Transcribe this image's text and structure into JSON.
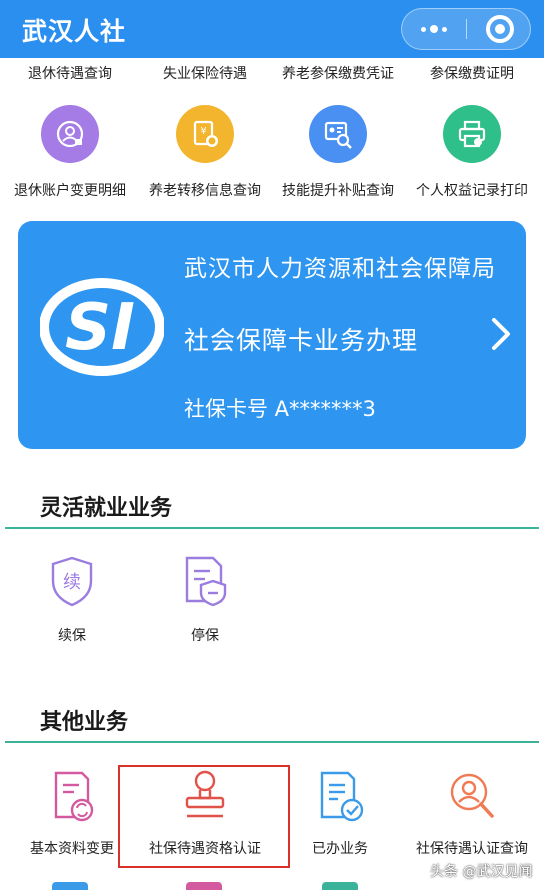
{
  "app": {
    "title": "武汉人社"
  },
  "top_row": {
    "labels": [
      "退休待遇查询",
      "失业保险待遇",
      "养老参保缴费凭证",
      "参保缴费证明"
    ]
  },
  "grid_row2": {
    "items": [
      {
        "label": "退休账户变更明细",
        "icon": "user-card-icon",
        "color": "#a57be6"
      },
      {
        "label": "养老转移信息查询",
        "icon": "yuan-document-icon",
        "color": "#f2b52d"
      },
      {
        "label": "技能提升补贴查询",
        "icon": "id-search-icon",
        "color": "#4a8ff2"
      },
      {
        "label": "个人权益记录打印",
        "icon": "printer-icon",
        "color": "#2fbf8a"
      }
    ]
  },
  "ss_card": {
    "org": "武汉市人力资源和社会保障局",
    "title": "社会保障卡业务办理",
    "card_number": "社保卡号 A*******3",
    "logo_text": "SI"
  },
  "flexible_section": {
    "title": "灵活就业业务",
    "items": [
      {
        "label": "续保",
        "icon": "shield-continue-icon",
        "icon_text": "续",
        "color": "#9b7de0"
      },
      {
        "label": "停保",
        "icon": "document-shield-icon",
        "color": "#9b7de0"
      }
    ]
  },
  "other_section": {
    "title": "其他业务",
    "items": [
      {
        "label": "基本资料变更",
        "icon": "document-refresh-icon",
        "color": "#d45aa0"
      },
      {
        "label": "社保待遇资格认证",
        "icon": "stamp-icon",
        "color": "#e0524a"
      },
      {
        "label": "已办业务",
        "icon": "document-check-icon",
        "color": "#3b9be8"
      },
      {
        "label": "社保待遇认证查询",
        "icon": "person-search-icon",
        "color": "#f07a54"
      }
    ]
  },
  "watermark": "头条 @武汉见闻"
}
